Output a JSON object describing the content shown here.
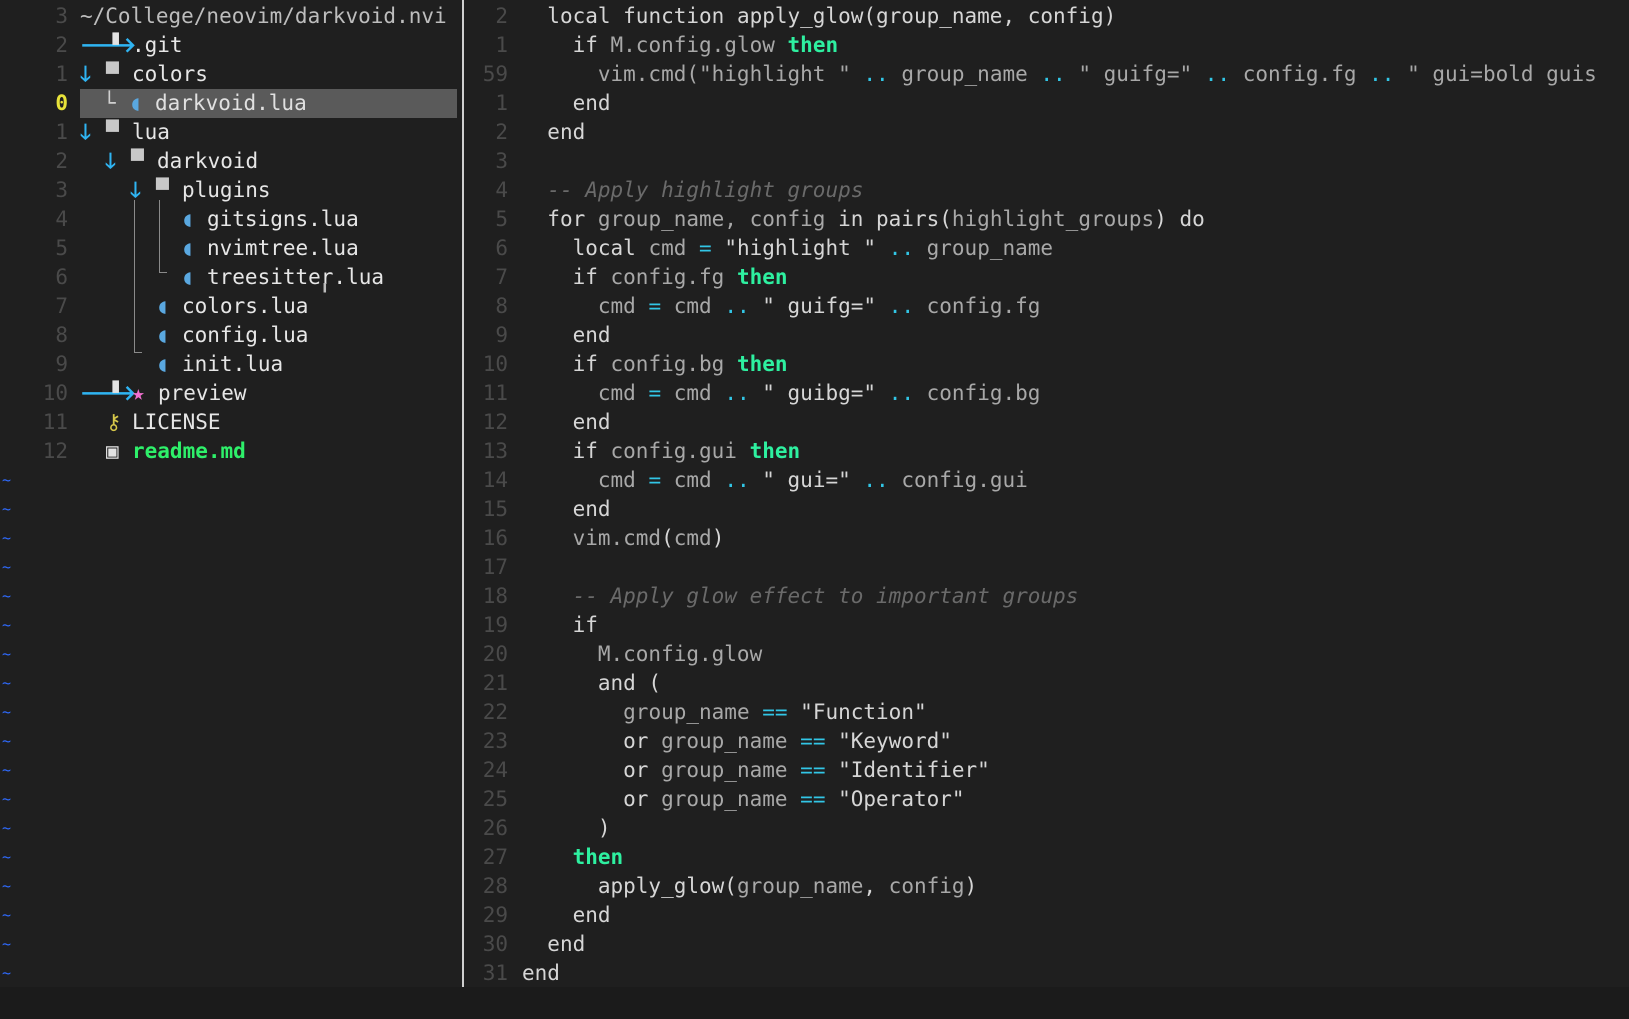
{
  "tree": {
    "header": "~/College/neovim/darkvoid.nvi",
    "lines": [
      {
        "num": "3",
        "depth": 0,
        "arrow": "",
        "icon": "",
        "label": "~/College/neovim/darkvoid.nvi",
        "kind": "header"
      },
      {
        "num": "2",
        "depth": 0,
        "arrow": "right",
        "icon": "file",
        "label": ".git",
        "kind": "dir"
      },
      {
        "num": "1",
        "depth": 0,
        "arrow": "down",
        "icon": "folder",
        "label": "colors",
        "kind": "dir"
      },
      {
        "num": "0",
        "depth": 1,
        "arrow": "",
        "icon": "lua",
        "label": "darkvoid.lua",
        "kind": "file",
        "selected": true
      },
      {
        "num": "1",
        "depth": 0,
        "arrow": "down",
        "icon": "folder",
        "label": "lua",
        "kind": "dir"
      },
      {
        "num": "2",
        "depth": 1,
        "arrow": "down",
        "icon": "folder",
        "label": "darkvoid",
        "kind": "dir"
      },
      {
        "num": "3",
        "depth": 2,
        "arrow": "down",
        "icon": "folder",
        "label": "plugins",
        "kind": "dir"
      },
      {
        "num": "4",
        "depth": 3,
        "arrow": "",
        "icon": "lua",
        "label": "gitsigns.lua",
        "kind": "file"
      },
      {
        "num": "5",
        "depth": 3,
        "arrow": "",
        "icon": "lua",
        "label": "nvimtree.lua",
        "kind": "file"
      },
      {
        "num": "6",
        "depth": 3,
        "arrow": "",
        "icon": "lua",
        "label": "treesitter.lua",
        "kind": "file"
      },
      {
        "num": "7",
        "depth": 2,
        "arrow": "",
        "icon": "lua",
        "label": "colors.lua",
        "kind": "file"
      },
      {
        "num": "8",
        "depth": 2,
        "arrow": "",
        "icon": "lua",
        "label": "config.lua",
        "kind": "file"
      },
      {
        "num": "9",
        "depth": 2,
        "arrow": "",
        "icon": "lua",
        "label": "init.lua",
        "kind": "file"
      },
      {
        "num": "10",
        "depth": 0,
        "arrow": "right",
        "icon": "file-star",
        "label": "preview",
        "kind": "dir"
      },
      {
        "num": "11",
        "depth": 0,
        "arrow": "",
        "icon": "license",
        "label": "LICENSE",
        "kind": "file"
      },
      {
        "num": "12",
        "depth": 0,
        "arrow": "",
        "icon": "md",
        "label": "readme.md",
        "kind": "readme"
      }
    ],
    "tilde_count": 18,
    "tilde_char": "~",
    "icons": {
      "arrow_down": "🡓",
      "arrow_right": "🡒",
      "file": "▝",
      "folder": "▀",
      "lua": "◖",
      "file_star": "▝",
      "star": "★",
      "license": "⚷",
      "md": "▣",
      "branch": "└"
    }
  },
  "editor": {
    "lines": [
      {
        "num": "2",
        "tokens": [
          [
            "pl",
            "local function apply_glow(group_name, config)"
          ]
        ],
        "indent": 1
      },
      {
        "num": "1",
        "tokens": [
          [
            "pl",
            "if "
          ],
          [
            "id",
            "M.config.glow "
          ],
          [
            "then",
            "then"
          ]
        ],
        "indent": 2
      },
      {
        "num": "59",
        "tokens": [
          [
            "id",
            "vim.cmd(\"highlight \" "
          ],
          [
            "op",
            ".."
          ],
          [
            "id",
            " group_name "
          ],
          [
            "op",
            ".."
          ],
          [
            "id",
            " \" guifg=\" "
          ],
          [
            "op",
            ".."
          ],
          [
            "id",
            " config.fg "
          ],
          [
            "op",
            ".."
          ],
          [
            "id",
            " \" gui=bold guis"
          ]
        ],
        "indent": 3
      },
      {
        "num": "1",
        "tokens": [
          [
            "pl",
            "end"
          ]
        ],
        "indent": 2
      },
      {
        "num": "2",
        "tokens": [
          [
            "pl",
            "end"
          ]
        ],
        "indent": 1
      },
      {
        "num": "3",
        "tokens": [],
        "indent": 0
      },
      {
        "num": "4",
        "tokens": [
          [
            "cm",
            "-- Apply highlight groups"
          ]
        ],
        "indent": 1
      },
      {
        "num": "5",
        "tokens": [
          [
            "pl",
            "for "
          ],
          [
            "id",
            "group_name, config "
          ],
          [
            "pl",
            "in pairs("
          ],
          [
            "id",
            "highlight_groups"
          ],
          [
            "pl",
            ") do"
          ]
        ],
        "indent": 1
      },
      {
        "num": "6",
        "tokens": [
          [
            "pl",
            "local "
          ],
          [
            "id",
            "cmd "
          ],
          [
            "op",
            "="
          ],
          [
            "pl",
            " \"highlight \" "
          ],
          [
            "op",
            ".."
          ],
          [
            "id",
            " group_name"
          ]
        ],
        "indent": 2
      },
      {
        "num": "7",
        "tokens": [
          [
            "pl",
            "if "
          ],
          [
            "id",
            "config.fg "
          ],
          [
            "then",
            "then"
          ]
        ],
        "indent": 2
      },
      {
        "num": "8",
        "tokens": [
          [
            "id",
            "cmd "
          ],
          [
            "op",
            "="
          ],
          [
            "id",
            " cmd "
          ],
          [
            "op",
            ".."
          ],
          [
            "pl",
            " \" guifg=\" "
          ],
          [
            "op",
            ".."
          ],
          [
            "id",
            " config.fg"
          ]
        ],
        "indent": 3
      },
      {
        "num": "9",
        "tokens": [
          [
            "pl",
            "end"
          ]
        ],
        "indent": 2
      },
      {
        "num": "10",
        "tokens": [
          [
            "pl",
            "if "
          ],
          [
            "id",
            "config.bg "
          ],
          [
            "then",
            "then"
          ]
        ],
        "indent": 2
      },
      {
        "num": "11",
        "tokens": [
          [
            "id",
            "cmd "
          ],
          [
            "op",
            "="
          ],
          [
            "id",
            " cmd "
          ],
          [
            "op",
            ".."
          ],
          [
            "pl",
            " \" guibg=\" "
          ],
          [
            "op",
            ".."
          ],
          [
            "id",
            " config.bg"
          ]
        ],
        "indent": 3
      },
      {
        "num": "12",
        "tokens": [
          [
            "pl",
            "end"
          ]
        ],
        "indent": 2
      },
      {
        "num": "13",
        "tokens": [
          [
            "pl",
            "if "
          ],
          [
            "id",
            "config.gui "
          ],
          [
            "then",
            "then"
          ]
        ],
        "indent": 2
      },
      {
        "num": "14",
        "tokens": [
          [
            "id",
            "cmd "
          ],
          [
            "op",
            "="
          ],
          [
            "id",
            " cmd "
          ],
          [
            "op",
            ".."
          ],
          [
            "pl",
            " \" gui=\" "
          ],
          [
            "op",
            ".."
          ],
          [
            "id",
            " config.gui"
          ]
        ],
        "indent": 3
      },
      {
        "num": "15",
        "tokens": [
          [
            "pl",
            "end"
          ]
        ],
        "indent": 2
      },
      {
        "num": "16",
        "tokens": [
          [
            "id",
            "vim.cmd"
          ],
          [
            "pl",
            "("
          ],
          [
            "id",
            "cmd"
          ],
          [
            "pl",
            ")"
          ]
        ],
        "indent": 2
      },
      {
        "num": "17",
        "tokens": [],
        "indent": 0
      },
      {
        "num": "18",
        "tokens": [
          [
            "cm",
            "-- Apply glow effect to important groups"
          ]
        ],
        "indent": 2
      },
      {
        "num": "19",
        "tokens": [
          [
            "pl",
            "if"
          ]
        ],
        "indent": 2
      },
      {
        "num": "20",
        "tokens": [
          [
            "id",
            "M.config.glow"
          ]
        ],
        "indent": 3
      },
      {
        "num": "21",
        "tokens": [
          [
            "pl",
            "and ("
          ]
        ],
        "indent": 3
      },
      {
        "num": "22",
        "tokens": [
          [
            "id",
            "group_name "
          ],
          [
            "op",
            "=="
          ],
          [
            "pl",
            " \"Function\""
          ]
        ],
        "indent": 4
      },
      {
        "num": "23",
        "tokens": [
          [
            "pl",
            "or "
          ],
          [
            "id",
            "group_name "
          ],
          [
            "op",
            "=="
          ],
          [
            "pl",
            " \"Keyword\""
          ]
        ],
        "indent": 4
      },
      {
        "num": "24",
        "tokens": [
          [
            "pl",
            "or "
          ],
          [
            "id",
            "group_name "
          ],
          [
            "op",
            "=="
          ],
          [
            "pl",
            " \"Identifier\""
          ]
        ],
        "indent": 4
      },
      {
        "num": "25",
        "tokens": [
          [
            "pl",
            "or "
          ],
          [
            "id",
            "group_name "
          ],
          [
            "op",
            "=="
          ],
          [
            "pl",
            " \"Operator\""
          ]
        ],
        "indent": 4
      },
      {
        "num": "26",
        "tokens": [
          [
            "pl",
            ")"
          ]
        ],
        "indent": 3
      },
      {
        "num": "27",
        "tokens": [
          [
            "then",
            "then"
          ]
        ],
        "indent": 2
      },
      {
        "num": "28",
        "tokens": [
          [
            "pl",
            "apply_glow("
          ],
          [
            "id",
            "group_name"
          ],
          [
            "pl",
            ", "
          ],
          [
            "id",
            "config"
          ],
          [
            "pl",
            ")"
          ]
        ],
        "indent": 3
      },
      {
        "num": "29",
        "tokens": [
          [
            "pl",
            "end"
          ]
        ],
        "indent": 2
      },
      {
        "num": "30",
        "tokens": [
          [
            "pl",
            "end"
          ]
        ],
        "indent": 1
      },
      {
        "num": "31",
        "tokens": [
          [
            "pl",
            "end"
          ]
        ],
        "indent": 0
      }
    ]
  },
  "colors": {
    "background": "#1f1f1f",
    "line_number": "#4a4a4a",
    "current_line_number": "#e8e33a",
    "tree_arrow": "#2fb4f2",
    "keyword_then": "#2ef0a0",
    "operator": "#32c6e6",
    "comment": "#6a6a6a",
    "readme": "#2ef06a",
    "tilde": "#2f6bff",
    "selection": "#5a5a5a"
  }
}
